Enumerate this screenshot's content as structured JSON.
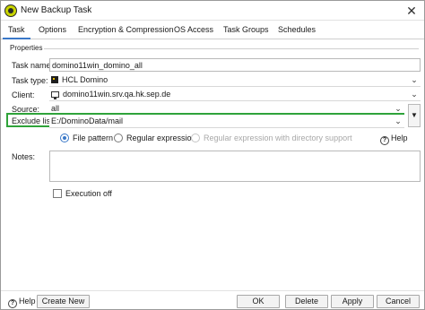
{
  "window": {
    "title": "New Backup Task",
    "close_glyph": "✕"
  },
  "tabs": [
    {
      "label": "Task"
    },
    {
      "label": "Options"
    },
    {
      "label": "Encryption & Compression"
    },
    {
      "label": "OS Access"
    },
    {
      "label": "Task Groups"
    },
    {
      "label": "Schedules"
    }
  ],
  "properties": {
    "section_label": "Properties",
    "task_name": {
      "label": "Task name:",
      "value": "domino11win_domino_all"
    },
    "task_type": {
      "label": "Task type:",
      "value": "HCL Domino"
    },
    "client": {
      "label": "Client:",
      "value": "domino11win.srv.qa.hk.sep.de"
    },
    "source": {
      "label": "Source:",
      "value": "all"
    },
    "exclude_list": {
      "label": "Exclude list:",
      "value": "E:/DominoData/mail"
    },
    "pattern_options": {
      "selected": "File pattern",
      "file_pattern": "File pattern",
      "regular_expression": "Regular expression",
      "regex_dir": "Regular expression with directory support"
    },
    "help_label": "Help",
    "notes": {
      "label": "Notes:",
      "value": ""
    },
    "execution_off": {
      "label": "Execution off",
      "checked": false
    }
  },
  "footer": {
    "help": "Help",
    "create_new": "Create New",
    "ok": "OK",
    "delete": "Delete",
    "apply": "Apply",
    "cancel": "Cancel"
  },
  "colors": {
    "highlight_border": "#2fa33a",
    "accent": "#3a78c8"
  }
}
